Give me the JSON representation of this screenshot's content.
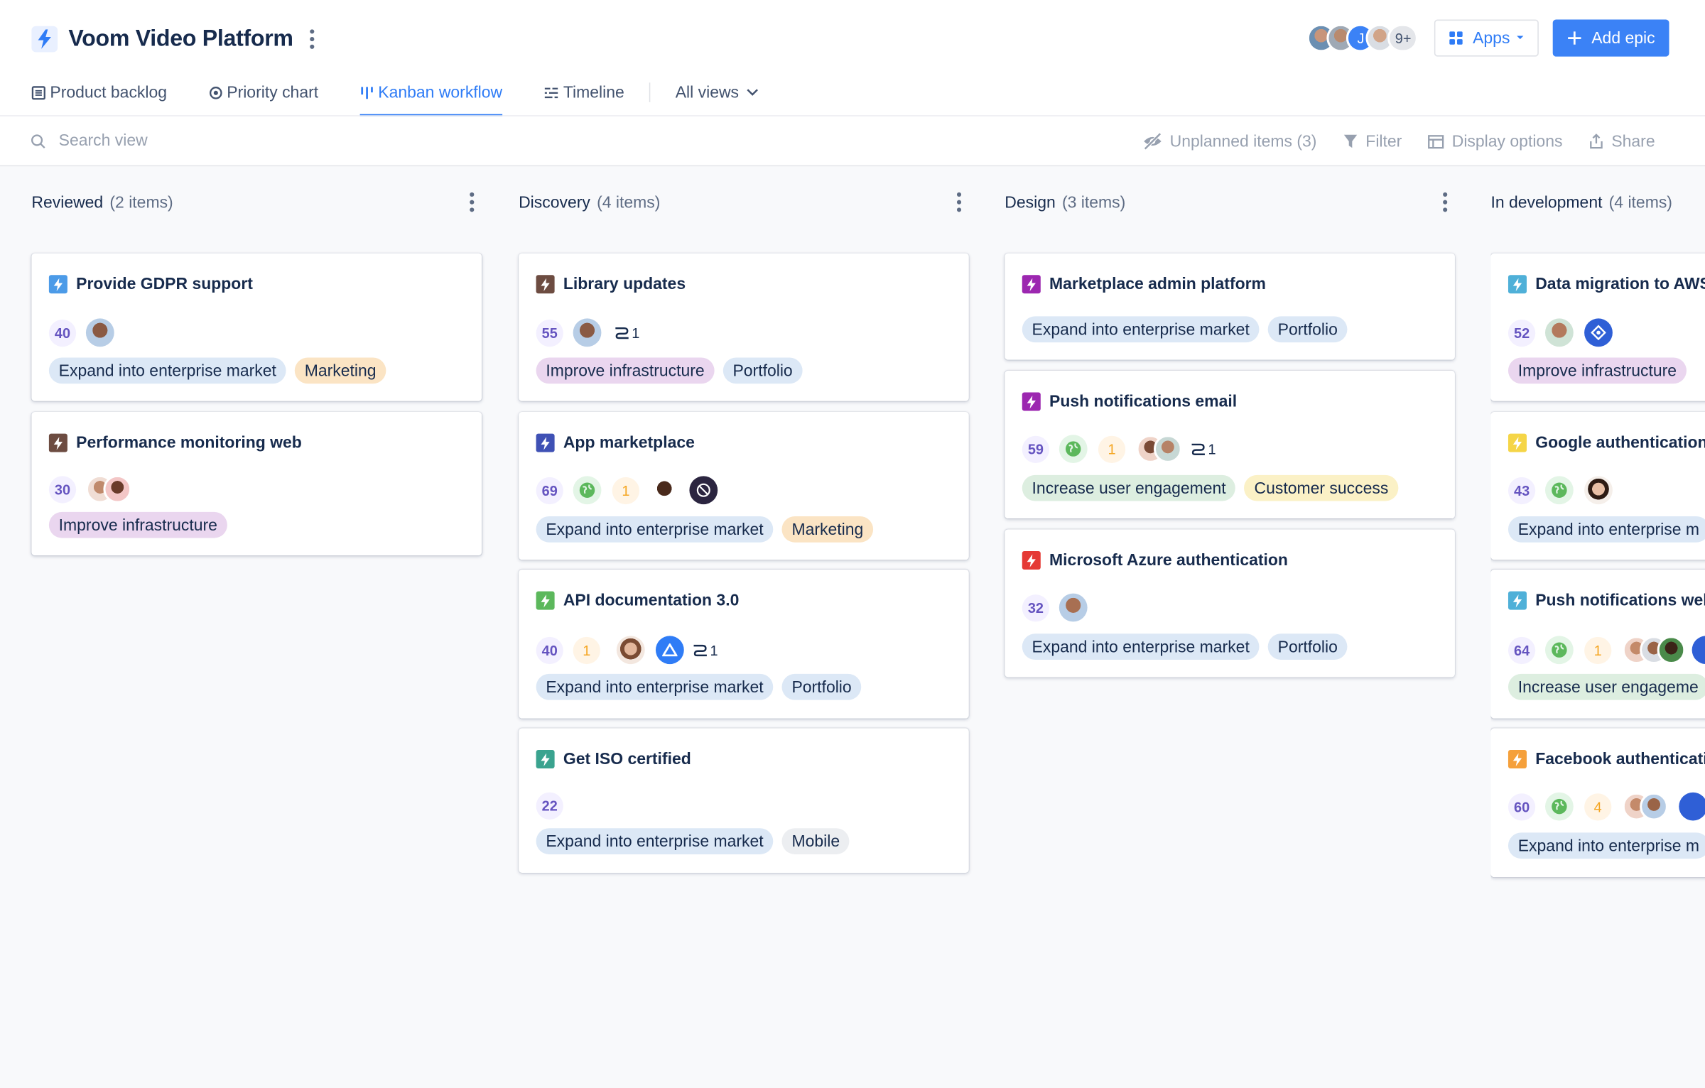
{
  "header": {
    "title": "Voom Video Platform",
    "more_count": "9+",
    "apps_label": "Apps",
    "add_label": "Add epic"
  },
  "tabs": [
    {
      "label": "Product backlog",
      "icon": "list-icon"
    },
    {
      "label": "Priority chart",
      "icon": "target-icon"
    },
    {
      "label": "Kanban workflow",
      "icon": "kanban-icon",
      "active": true
    },
    {
      "label": "Timeline",
      "icon": "timeline-icon"
    }
  ],
  "all_views_label": "All views",
  "toolbar": {
    "search_placeholder": "Search view",
    "unplanned_label": "Unplanned items (3)",
    "filter_label": "Filter",
    "display_label": "Display options",
    "share_label": "Share"
  },
  "colors": {
    "accent": "#3b82f6",
    "score_text": "#6554c0",
    "count_text": "#f5a623"
  },
  "columns": [
    {
      "name": "Reviewed",
      "count": "(2 items)",
      "cards": [
        {
          "title": "Provide GDPR support",
          "icon_color": "#4c9be8",
          "score": "40",
          "tags": [
            "Expand into enterprise market",
            "Marketing"
          ]
        },
        {
          "title": "Performance monitoring web",
          "icon_color": "#6d4c41",
          "score": "30",
          "tags": [
            "Improve infrastructure"
          ]
        }
      ]
    },
    {
      "name": "Discovery",
      "count": "(4 items)",
      "cards": [
        {
          "title": "Library updates",
          "icon_color": "#6d4c41",
          "score": "55",
          "links": "1",
          "tags": [
            "Improve infrastructure",
            "Portfolio"
          ]
        },
        {
          "title": "App marketplace",
          "icon_color": "#3f51b5",
          "score": "69",
          "num": "1",
          "tags": [
            "Expand into enterprise market",
            "Marketing"
          ]
        },
        {
          "title": "API documentation 3.0",
          "icon_color": "#5cb85c",
          "score": "40",
          "num": "1",
          "links": "1",
          "tags": [
            "Expand into enterprise market",
            "Portfolio"
          ]
        },
        {
          "title": "Get ISO certified",
          "icon_color": "#3aa38f",
          "score": "22",
          "tags": [
            "Expand into enterprise market",
            "Mobile"
          ]
        }
      ]
    },
    {
      "name": "Design",
      "count": "(3 items)",
      "cards": [
        {
          "title": "Marketplace admin platform",
          "icon_color": "#9c27b0",
          "tags": [
            "Expand into enterprise market",
            "Portfolio"
          ]
        },
        {
          "title": "Push notifications email",
          "icon_color": "#9c27b0",
          "score": "59",
          "num": "1",
          "links": "1",
          "tags": [
            "Increase user engagement",
            "Customer success"
          ]
        },
        {
          "title": "Microsoft Azure authentication",
          "icon_color": "#e53935",
          "score": "32",
          "tags": [
            "Expand into enterprise market",
            "Portfolio"
          ]
        }
      ]
    },
    {
      "name": "In development",
      "count": "(4 items)",
      "cards": [
        {
          "title": "Data migration to AWS",
          "icon_color": "#4fb0d8",
          "score": "52",
          "tags": [
            "Improve infrastructure"
          ]
        },
        {
          "title": "Google authentication",
          "icon_color": "#f5d547",
          "score": "43",
          "tags": [
            "Expand into enterprise m"
          ]
        },
        {
          "title": "Push notifications web",
          "icon_color": "#4fb0d8",
          "score": "64",
          "num": "1",
          "tags": [
            "Increase user engageme"
          ]
        },
        {
          "title": "Facebook authenticati",
          "icon_color": "#f5a03b",
          "score": "60",
          "num": "4",
          "tags": [
            "Expand into enterprise m"
          ]
        }
      ]
    }
  ]
}
